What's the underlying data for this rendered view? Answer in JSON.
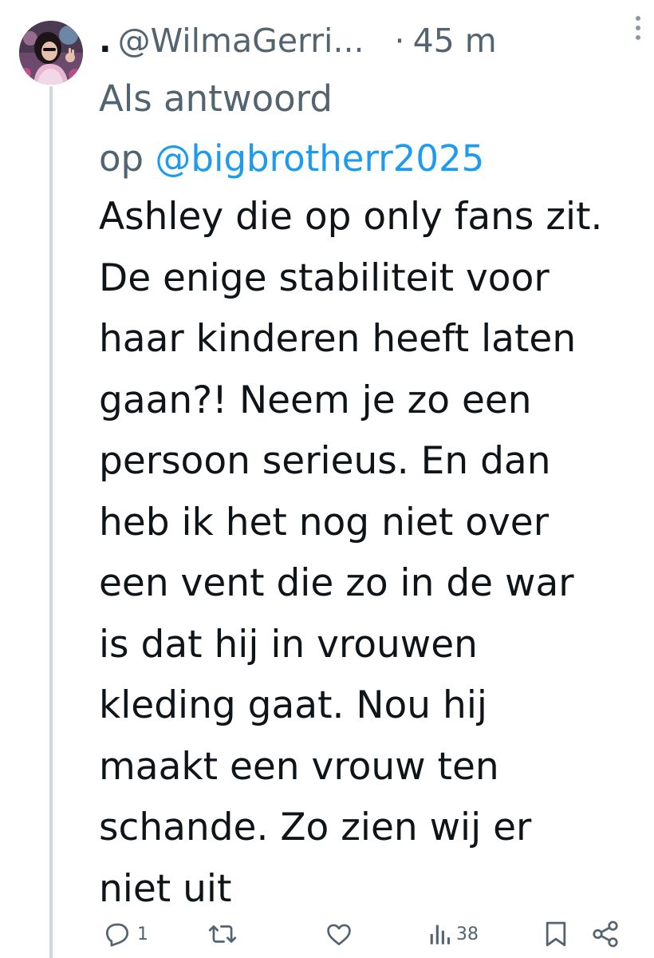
{
  "tweet": {
    "author": {
      "name_fragment": ".",
      "handle": "@WilmaGerri..."
    },
    "separator": "·",
    "time": "45 m",
    "reply_context": {
      "prefix_line1": "Als antwoord",
      "prefix_line2": "op ",
      "mention": "@bigbrotherr2025"
    },
    "text_lines": [
      "Ashley die op only fans zit.",
      "De enige stabiliteit voor",
      "haar kinderen heeft laten",
      "gaan?! Neem je zo een",
      "persoon serieus. En dan",
      "heb ik het nog niet over",
      "een vent die zo in de war",
      "is dat hij in vrouwen",
      "kleding gaat. Nou hij",
      "maakt een vrouw ten",
      "schande. Zo zien wij er",
      "niet uit"
    ],
    "actions": {
      "reply": {
        "icon": "reply-icon",
        "count": "1"
      },
      "retweet": {
        "icon": "retweet-icon",
        "count": ""
      },
      "like": {
        "icon": "heart-icon",
        "count": ""
      },
      "views": {
        "icon": "views-icon",
        "count": "38"
      },
      "bookmark": {
        "icon": "bookmark-icon"
      },
      "share": {
        "icon": "share-icon"
      }
    }
  },
  "colors": {
    "text_primary": "#0f1419",
    "text_secondary": "#536471",
    "link": "#1d9bf0",
    "thread_line": "#cfd9de",
    "icon": "#536471"
  }
}
